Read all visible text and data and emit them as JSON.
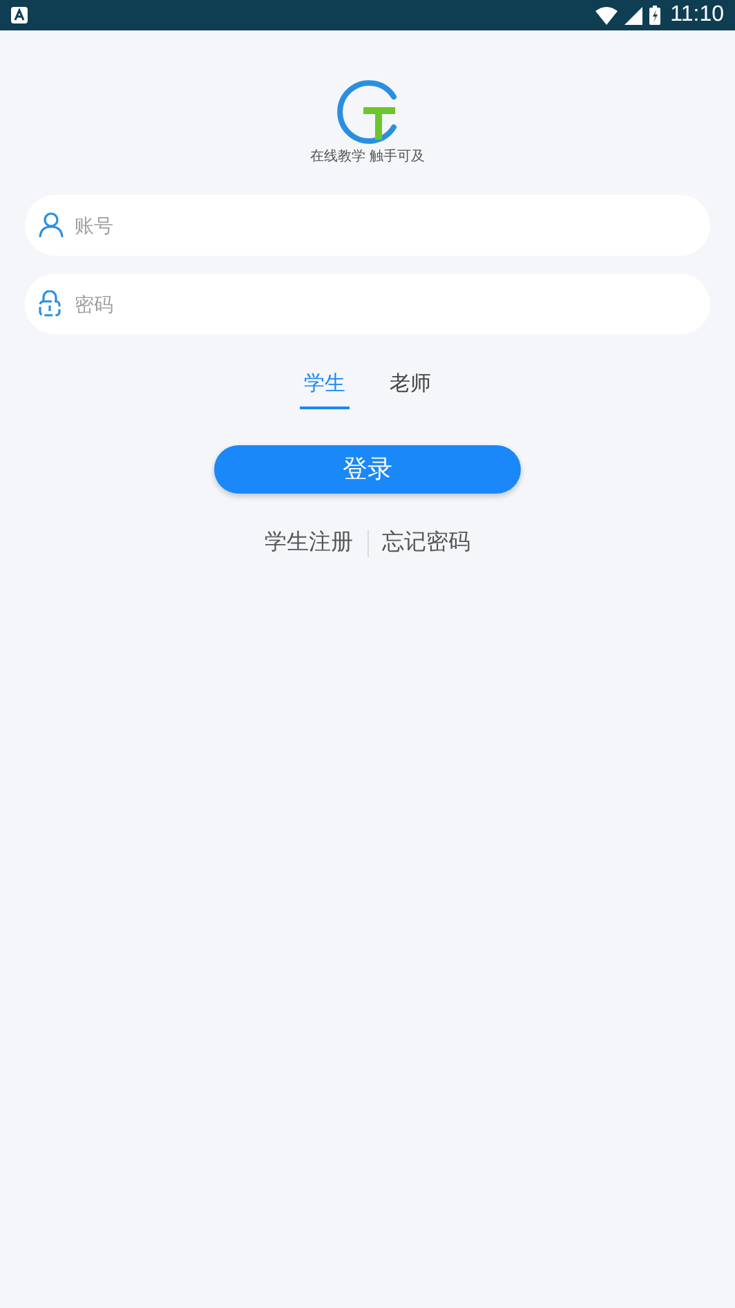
{
  "status_bar": {
    "time": "11:10"
  },
  "logo": {
    "tagline": "在线教学 触手可及"
  },
  "fields": [
    {
      "kind": "account",
      "placeholder": "账号"
    },
    {
      "kind": "password",
      "placeholder": "密码"
    }
  ],
  "tabs": [
    {
      "label": "学生",
      "selected": true
    },
    {
      "label": "老师",
      "selected": false
    }
  ],
  "login_button": "登录",
  "links": [
    "学生注册",
    "忘记密码"
  ]
}
